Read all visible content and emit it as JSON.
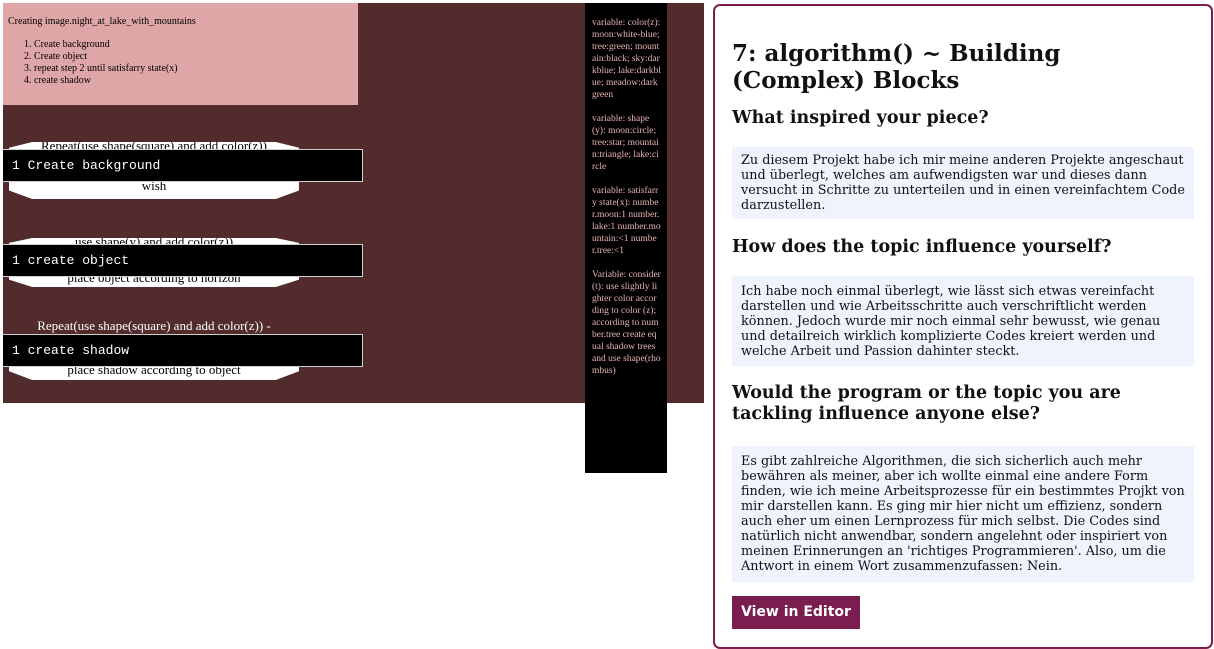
{
  "artwork": {
    "recipe": {
      "title": "Creating image.night_at_lake_with_mountains",
      "steps": [
        "Create background",
        "Create object",
        "repeat step 2 until satisfarry state(x)",
        "create shadow"
      ]
    },
    "clouds": [
      {
        "line1": "Repeat(use shape(square) and add color(z))",
        "line2": "wish"
      },
      {
        "line1": "use shape(y) and add color(z))",
        "line2": "place object according to horizon"
      },
      {
        "line1": "Repeat(use shape(square) and add color(z)) -",
        "line2": "place shadow according to object"
      }
    ],
    "code_lines": [
      {
        "num": "1",
        "text": "Create background"
      },
      {
        "num": "1",
        "text": "create object"
      },
      {
        "num": "1",
        "text": "create shadow"
      }
    ]
  },
  "variables": [
    "variable: color(z): moon:white-blue; tree:green; mountain:black; sky:darkblue; lake:darkblue; meadow:darkgreen",
    "variable: shape(y): moon:circle; tree:star; mountain:triangle; lake:circle",
    "variable: satisfarry state(x): number.moon:1 number.lake:1 number.mountain:<1 number.tree:<1",
    "Variable: consider (t): use slightly lighter color according to color (z); according to number.tree create equal shadow trees and use shape(rhombus)"
  ],
  "panel": {
    "title": "7: algorithm() ~ Building (Complex) Blocks",
    "q1": "What inspired your piece?",
    "a1": "Zu diesem Projekt habe ich mir meine anderen Projekte angeschaut und überlegt, welches am aufwendigsten war und dieses dann versucht in Schritte zu unterteilen und in einen vereinfachtem Code darzustellen.",
    "q2": "How does the topic influence yourself?",
    "a2": "Ich habe noch einmal überlegt, wie lässt sich etwas vereinfacht darstellen und wie Arbeitsschritte auch verschriftlicht werden können. Jedoch wurde mir noch einmal sehr bewusst, wie genau und detailreich wirklich komplizierte Codes kreiert werden und welche Arbeit und Passion dahinter steckt.",
    "q3": "Would the program or the topic you are tackling influence anyone else?",
    "a3": "Es gibt zahlreiche Algorithmen, die sich sicherlich auch mehr bewähren als meiner, aber ich wollte einmal eine andere Form finden, wie ich meine Arbeitsprozesse für ein bestimmtes Projkt von mir darstellen kann. Es ging mir hier nicht um effizienz, sondern auch eher um einen Lernprozess für mich selbst. Die Codes sind natürlich nicht anwendbar, sondern angelehnt oder inspiriert von meinen Erinnerungen an 'richtiges Programmieren'. Also, um die Antwort in einem Wort zusammenzufassen: Nein.",
    "button": "View in Editor"
  },
  "colors": {
    "canvas_bg": "#522b2c",
    "recipe_bg": "#dea6a6",
    "accent": "#7a1d4f",
    "answer_bg": "#eef3fd"
  }
}
